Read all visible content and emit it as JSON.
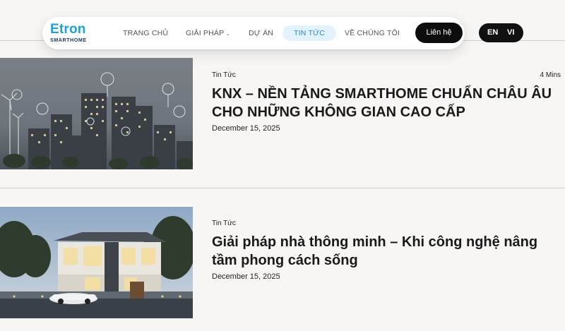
{
  "brand": {
    "name": "Etron",
    "sub": "SMARTHOME"
  },
  "nav": {
    "items": [
      {
        "label": "TRANG CHỦ"
      },
      {
        "label": "GIẢI PHÁP"
      },
      {
        "label": "DỰ ÁN"
      },
      {
        "label": "TIN TỨC"
      },
      {
        "label": "VỀ CHÚNG TÔI"
      }
    ],
    "active": "TIN TỨC",
    "contact_label": "Liên hệ"
  },
  "lang": {
    "en": "EN",
    "vi": "VI",
    "selected": "VI"
  },
  "articles": [
    {
      "category": "Tin Tức",
      "read_time": "4 Mins",
      "title": "KNX – NỀN TẢNG SMARTHOME CHUẨN CHÂU ÂU CHO NHỮNG KHÔNG GIAN CAO CẤP",
      "date": "December 15, 2025"
    },
    {
      "category": "Tin Tức",
      "title": "Giải pháp nhà thông minh – Khi công nghệ nâng tầm phong cách sống",
      "date": "December 15, 2025"
    }
  ],
  "colors": {
    "brand": "#1aa4d8",
    "active_bg": "#e3f2fc",
    "active_text": "#2289c9",
    "dark": "#0d0d0d"
  }
}
